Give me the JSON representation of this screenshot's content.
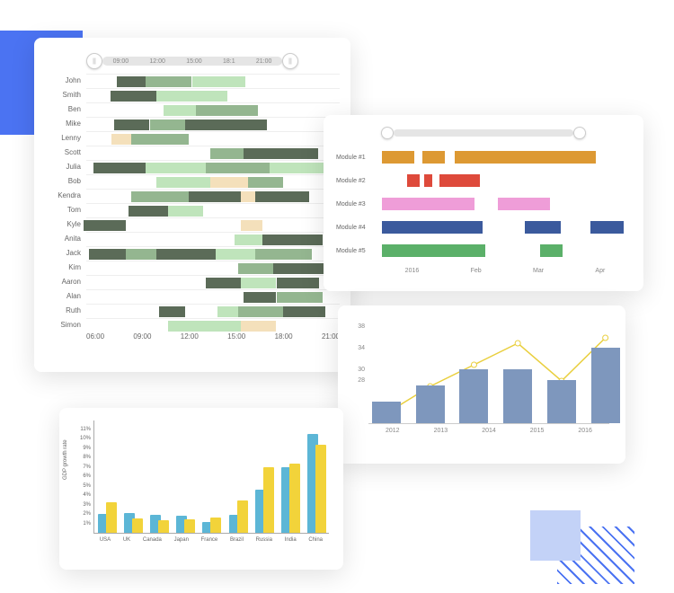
{
  "chart_data": [
    {
      "type": "gantt",
      "time_ticks": [
        "06:00",
        "09:00",
        "12:00",
        "15:00",
        "18:00",
        "21:00"
      ],
      "slider_labels": [
        "09:00",
        "12:00",
        "15:00",
        "18:1",
        "21:00"
      ],
      "time_range": [
        6,
        24
      ],
      "colors": {
        "dark": "#5b6b58",
        "mid": "#94b690",
        "light": "#bfe4bb",
        "cream": "#f4e0bb"
      },
      "rows": [
        {
          "name": "John",
          "bars": [
            {
              "s": 8.2,
              "e": 10.2,
              "c": "dark"
            },
            {
              "s": 10.2,
              "e": 13.5,
              "c": "mid"
            },
            {
              "s": 13.5,
              "e": 17.3,
              "c": "light"
            }
          ]
        },
        {
          "name": "Smith",
          "bars": [
            {
              "s": 7.7,
              "e": 11.0,
              "c": "dark"
            },
            {
              "s": 11.0,
              "e": 16.0,
              "c": "light"
            }
          ]
        },
        {
          "name": "Ben",
          "bars": [
            {
              "s": 11.5,
              "e": 13.8,
              "c": "light"
            },
            {
              "s": 13.8,
              "e": 18.2,
              "c": "mid"
            }
          ]
        },
        {
          "name": "Mike",
          "bars": [
            {
              "s": 8.0,
              "e": 10.5,
              "c": "dark"
            },
            {
              "s": 10.5,
              "e": 13.0,
              "c": "mid"
            },
            {
              "s": 13.0,
              "e": 18.8,
              "c": "dark"
            }
          ]
        },
        {
          "name": "Lenny",
          "bars": [
            {
              "s": 7.8,
              "e": 9.2,
              "c": "cream"
            },
            {
              "s": 9.2,
              "e": 13.3,
              "c": "mid"
            }
          ]
        },
        {
          "name": "Scott",
          "bars": [
            {
              "s": 14.8,
              "e": 17.2,
              "c": "mid"
            },
            {
              "s": 17.2,
              "e": 22.5,
              "c": "dark"
            }
          ]
        },
        {
          "name": "Julia",
          "bars": [
            {
              "s": 6.5,
              "e": 10.2,
              "c": "dark"
            },
            {
              "s": 10.2,
              "e": 14.5,
              "c": "light"
            },
            {
              "s": 14.5,
              "e": 19.0,
              "c": "mid"
            },
            {
              "s": 19.0,
              "e": 23.5,
              "c": "light"
            }
          ]
        },
        {
          "name": "Bob",
          "bars": [
            {
              "s": 11.0,
              "e": 14.8,
              "c": "light"
            },
            {
              "s": 14.8,
              "e": 17.5,
              "c": "cream"
            },
            {
              "s": 17.5,
              "e": 20.0,
              "c": "mid"
            }
          ]
        },
        {
          "name": "Kendra",
          "bars": [
            {
              "s": 9.2,
              "e": 13.3,
              "c": "mid"
            },
            {
              "s": 13.3,
              "e": 17.0,
              "c": "dark"
            },
            {
              "s": 17.0,
              "e": 18.0,
              "c": "cream"
            },
            {
              "s": 18.0,
              "e": 21.8,
              "c": "dark"
            }
          ]
        },
        {
          "name": "Tom",
          "bars": [
            {
              "s": 9.0,
              "e": 11.8,
              "c": "dark"
            },
            {
              "s": 11.8,
              "e": 14.3,
              "c": "light"
            }
          ]
        },
        {
          "name": "Kyle",
          "bars": [
            {
              "s": 5.8,
              "e": 8.8,
              "c": "dark"
            },
            {
              "s": 17.0,
              "e": 18.5,
              "c": "cream"
            }
          ]
        },
        {
          "name": "Anita",
          "bars": [
            {
              "s": 16.5,
              "e": 18.5,
              "c": "light"
            },
            {
              "s": 18.5,
              "e": 22.8,
              "c": "dark"
            }
          ]
        },
        {
          "name": "Jack",
          "bars": [
            {
              "s": 6.2,
              "e": 8.8,
              "c": "dark"
            },
            {
              "s": 8.8,
              "e": 11.0,
              "c": "mid"
            },
            {
              "s": 11.0,
              "e": 15.2,
              "c": "dark"
            },
            {
              "s": 15.2,
              "e": 18.0,
              "c": "light"
            },
            {
              "s": 18.0,
              "e": 22.0,
              "c": "mid"
            }
          ]
        },
        {
          "name": "Kim",
          "bars": [
            {
              "s": 16.8,
              "e": 19.3,
              "c": "mid"
            },
            {
              "s": 19.3,
              "e": 23.2,
              "c": "dark"
            }
          ]
        },
        {
          "name": "Aaron",
          "bars": [
            {
              "s": 14.5,
              "e": 17.0,
              "c": "dark"
            },
            {
              "s": 17.0,
              "e": 19.5,
              "c": "light"
            },
            {
              "s": 19.5,
              "e": 22.5,
              "c": "dark"
            }
          ]
        },
        {
          "name": "Alan",
          "bars": [
            {
              "s": 17.2,
              "e": 19.5,
              "c": "dark"
            },
            {
              "s": 19.5,
              "e": 22.8,
              "c": "mid"
            }
          ]
        },
        {
          "name": "Ruth",
          "bars": [
            {
              "s": 11.2,
              "e": 13.0,
              "c": "dark"
            },
            {
              "s": 15.3,
              "e": 16.8,
              "c": "light"
            },
            {
              "s": 16.8,
              "e": 20.0,
              "c": "mid"
            },
            {
              "s": 20.0,
              "e": 23.0,
              "c": "dark"
            }
          ]
        },
        {
          "name": "Simon",
          "bars": [
            {
              "s": 11.8,
              "e": 17.0,
              "c": "light"
            },
            {
              "s": 17.0,
              "e": 19.5,
              "c": "cream"
            }
          ]
        }
      ]
    },
    {
      "type": "gantt-modules",
      "x_ticks": [
        "2016",
        "Feb",
        "Mar",
        "Apr"
      ],
      "x_range": [
        0,
        5
      ],
      "rows": [
        {
          "name": "Module #1",
          "color": "#dd9933",
          "bars": [
            [
              0.05,
              0.7
            ],
            [
              0.85,
              1.3
            ],
            [
              1.5,
              4.3
            ]
          ]
        },
        {
          "name": "Module #2",
          "color": "#de4a3b",
          "bars": [
            [
              0.55,
              0.8
            ],
            [
              0.9,
              1.05
            ],
            [
              1.2,
              2.0
            ]
          ]
        },
        {
          "name": "Module #3",
          "color": "#ef9dd8",
          "bars": [
            [
              0.05,
              1.9
            ],
            [
              2.35,
              3.4
            ]
          ]
        },
        {
          "name": "Module #4",
          "color": "#3b5a9d",
          "bars": [
            [
              0.05,
              2.05
            ],
            [
              2.9,
              3.6
            ],
            [
              4.2,
              4.85
            ]
          ]
        },
        {
          "name": "Module #5",
          "color": "#5bb069",
          "bars": [
            [
              0.05,
              1.1
            ],
            [
              1.1,
              2.1
            ],
            [
              3.2,
              3.65
            ]
          ]
        }
      ]
    },
    {
      "type": "bar-line-combo",
      "categories": [
        "2012",
        "2013",
        "2014",
        "2015",
        "2016"
      ],
      "y_ticks": [
        28,
        30,
        34,
        38
      ],
      "ylim": [
        20,
        40
      ],
      "bar_color": "#7e97bd",
      "line_color": "#e9cf3e",
      "series": [
        {
          "name": "bars",
          "values": [
            24,
            27,
            30,
            30,
            28,
            34
          ],
          "x_offsets": [
            -1,
            0,
            1,
            2,
            3,
            4
          ]
        },
        {
          "name": "line",
          "values": [
            22,
            27,
            31,
            35,
            28,
            36
          ],
          "x_offsets": [
            -1,
            0,
            1,
            2,
            3,
            4
          ]
        }
      ]
    },
    {
      "type": "bar-grouped",
      "title": "",
      "ylabel": "GDP growth rate",
      "categories": [
        "USA",
        "UK",
        "Canada",
        "Japan",
        "France",
        "Brazil",
        "Russia",
        "India",
        "China"
      ],
      "y_ticks": [
        "1%",
        "2%",
        "3%",
        "4%",
        "5%",
        "6%",
        "7%",
        "8%",
        "9%",
        "10%",
        "11%"
      ],
      "ylim": [
        0,
        12
      ],
      "colors": {
        "a": "#5cb6d6",
        "b": "#f2d33a"
      },
      "series": [
        {
          "name": "a",
          "values": [
            2.0,
            2.1,
            1.9,
            1.8,
            1.1,
            1.9,
            4.6,
            7.0,
            10.5
          ]
        },
        {
          "name": "b",
          "values": [
            3.2,
            1.5,
            1.3,
            1.4,
            1.6,
            3.4,
            7.0,
            7.3,
            9.3
          ]
        }
      ]
    }
  ]
}
